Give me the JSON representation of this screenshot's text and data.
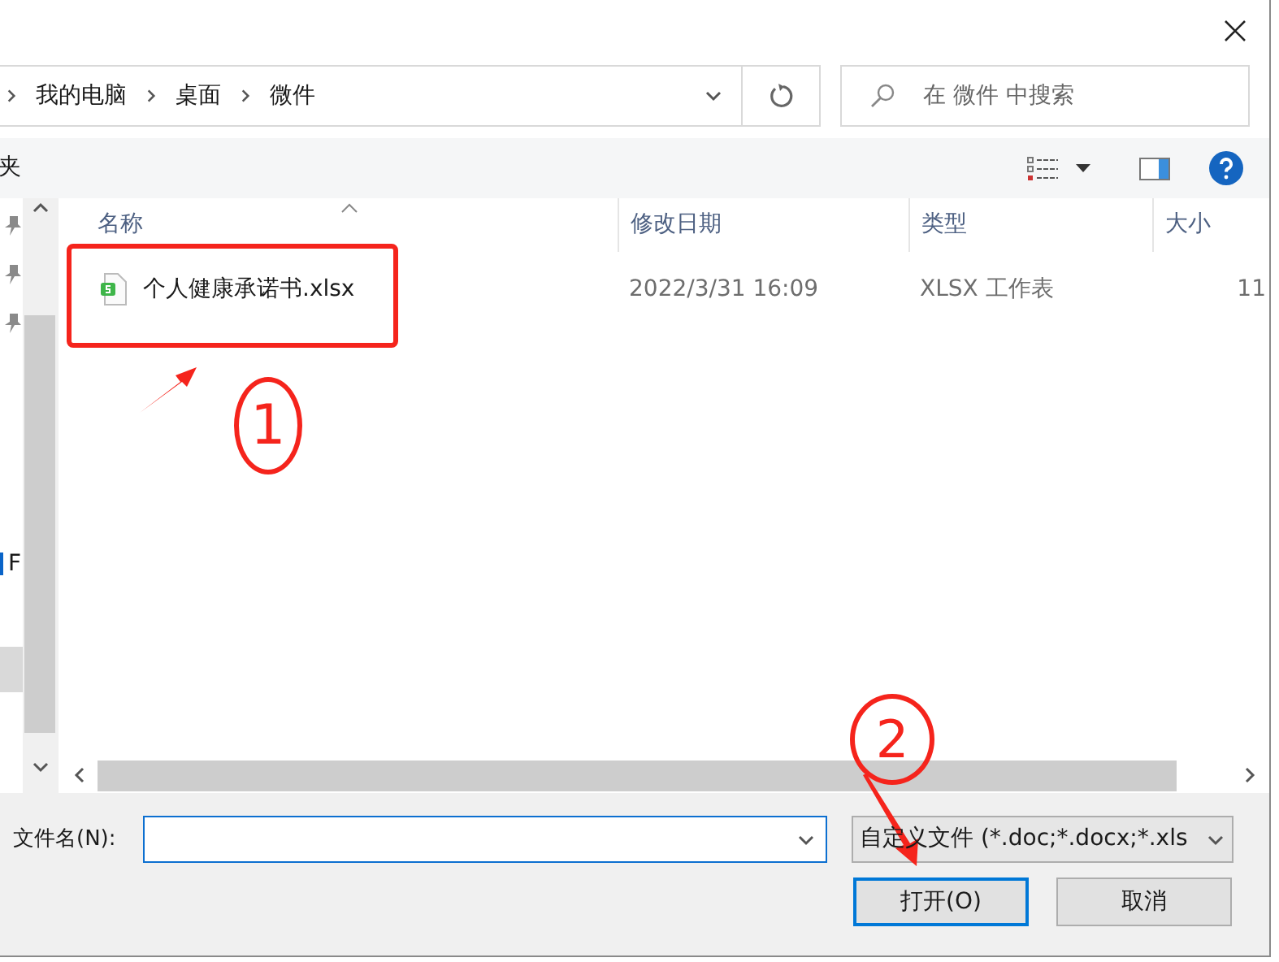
{
  "address_bar": {
    "breadcrumbs": [
      {
        "label": "我的电脑"
      },
      {
        "label": "桌面"
      },
      {
        "label": "微件"
      }
    ]
  },
  "search": {
    "placeholder": "在 微件 中搜索"
  },
  "toolbar": {
    "folder_label": "夹"
  },
  "navigation": {
    "items": [
      {
        "kind": "pin"
      },
      {
        "kind": "pin"
      },
      {
        "kind": "pin"
      },
      {
        "kind": "label",
        "label": "F"
      },
      {
        "kind": "highlight"
      }
    ]
  },
  "file_list": {
    "columns": [
      {
        "label": "名称",
        "sorted": true
      },
      {
        "label": "修改日期",
        "sorted": false
      },
      {
        "label": "类型",
        "sorted": false
      },
      {
        "label": "大小",
        "sorted": false
      }
    ],
    "rows": [
      {
        "name": "个人健康承诺书.xlsx",
        "modified": "2022/3/31 16:09",
        "type": "XLSX 工作表",
        "size": "11"
      }
    ]
  },
  "file_name": {
    "label": "文件名(N):"
  },
  "file_type": {
    "value": "自定义文件 (*.doc;*.docx;*.xls"
  },
  "buttons": [
    {
      "label": "打开(O)",
      "default": true
    },
    {
      "label": "取消",
      "default": false
    }
  ],
  "annotations": [
    {
      "label": "1"
    },
    {
      "label": "2"
    }
  ]
}
